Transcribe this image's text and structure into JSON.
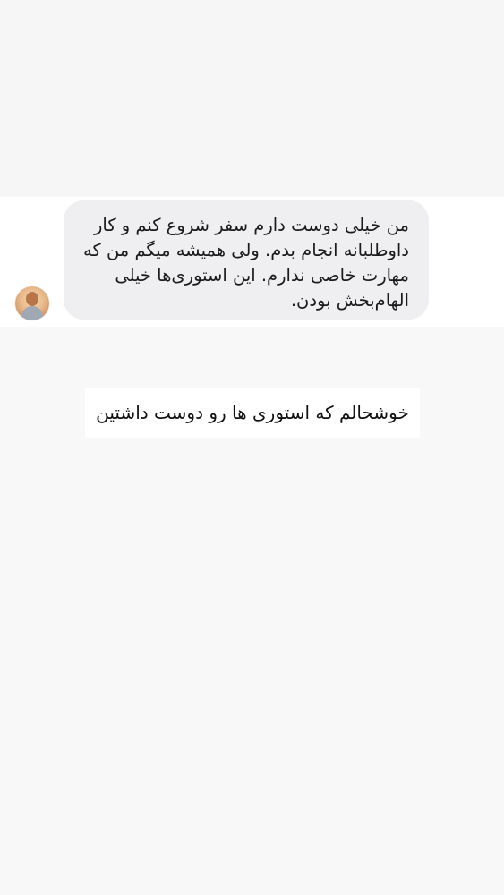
{
  "message": {
    "text": "من خیلی دوست دارم سفر شروع کنم و کار داوطلبانه انجام بدم. ولی همیشه میگم من که مهارت خاصی ندارم. این استوری‌ها خیلی الهام‌بخش بودن."
  },
  "reply": {
    "text": "خوشحالم که استوری ها رو دوست داشتین"
  },
  "colors": {
    "background": "#f8f8f9",
    "message_strip": "#ffffff",
    "bubble": "#efeff1",
    "reply_box": "#ffffff",
    "text": "#1b1b1b"
  }
}
